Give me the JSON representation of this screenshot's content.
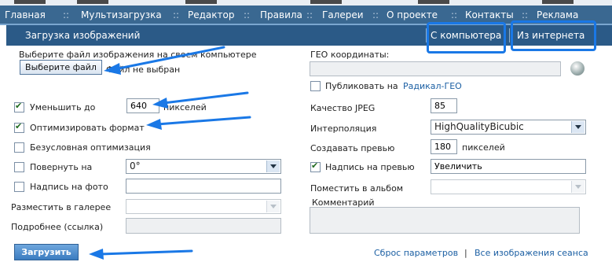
{
  "nav": {
    "items": [
      "Главная",
      "Мультизагрузка",
      "Редактор",
      "Правила",
      "Галереи",
      "О проекте",
      "Контакты",
      "Реклама"
    ],
    "separator": "::"
  },
  "header": {
    "title": "Загрузка изображений",
    "tab_computer": "С компьютера",
    "tab_internet": "Из интернета"
  },
  "file": {
    "prompt": "Выберите файл изображения на своем компьютере",
    "button": "Выберите файл",
    "status": "Файл не выбран"
  },
  "geo": {
    "label": "ГЕО координаты:",
    "value": "",
    "publish_label": "Публиковать на",
    "publish_link": "Радикал-ГЕО",
    "publish_checked": false
  },
  "left": {
    "reduce_label": "Уменьшить до",
    "reduce_checked": true,
    "reduce_value": "640",
    "reduce_unit": "пикселей",
    "optimize_label": "Оптимизировать формат",
    "optimize_checked": true,
    "uncond_label": "Безусловная оптимизация",
    "uncond_checked": false,
    "rotate_label": "Повернуть на",
    "rotate_checked": false,
    "rotate_value": "0°",
    "caption_label": "Надпись на фото",
    "caption_checked": false,
    "caption_value": "",
    "gallery_label": "Разместить в галерее",
    "gallery_value": "",
    "more_label": "Подробнее (ссылка)",
    "more_value": ""
  },
  "right": {
    "jpeg_label": "Качество JPEG",
    "jpeg_value": "85",
    "interp_label": "Интерполяция",
    "interp_value": "HighQualityBicubic",
    "preview_label": "Создавать превью",
    "preview_value": "180",
    "preview_unit": "пикселей",
    "preview_caption_label": "Надпись на превью",
    "preview_caption_checked": true,
    "preview_caption_value": "Увеличить",
    "album_label": "Поместить в альбом",
    "album_value": "",
    "comment_label": "Комментарий",
    "comment_value": ""
  },
  "footer": {
    "upload": "Загрузить",
    "reset": "Сброс параметров",
    "divider": "|",
    "session_images": "Все изображения сеанса"
  },
  "colors": {
    "nav_bg": "#3a6891",
    "header_bg": "#2b5a87",
    "annotation": "#1a78e6",
    "link": "#1b5fa3"
  }
}
